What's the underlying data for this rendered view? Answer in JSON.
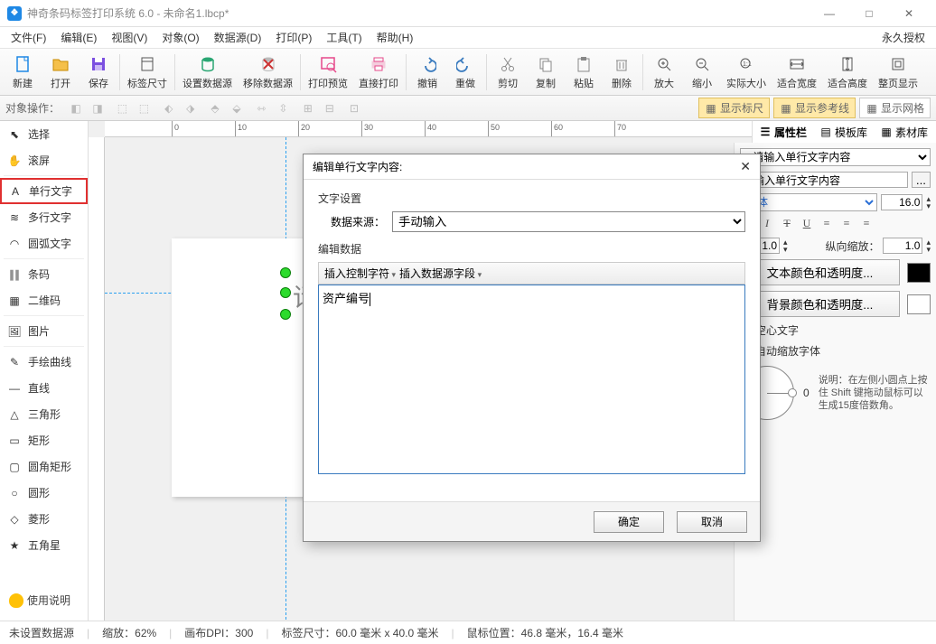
{
  "titlebar": {
    "text": "神奇条码标签打印系统 6.0 - 未命名1.lbcp*"
  },
  "menu": {
    "items": [
      "文件(F)",
      "编辑(E)",
      "视图(V)",
      "对象(O)",
      "数据源(D)",
      "打印(P)",
      "工具(T)",
      "帮助(H)"
    ],
    "rightlabel": "永久授权"
  },
  "maintb": [
    {
      "label": "新建",
      "icon": "#1e88e5",
      "shape": "doc"
    },
    {
      "label": "打开",
      "icon": "#f5a623",
      "shape": "folder"
    },
    {
      "label": "保存",
      "icon": "#7b4fe0",
      "shape": "floppy"
    },
    {
      "sep": true
    },
    {
      "label": "标签尺寸",
      "icon": "#555",
      "shape": "page"
    },
    {
      "sep": true
    },
    {
      "label": "设置数据源",
      "icon": "#2aa673",
      "shape": "db"
    },
    {
      "label": "移除数据源",
      "icon": "#c33",
      "shape": "dbx"
    },
    {
      "sep": true
    },
    {
      "label": "打印预览",
      "icon": "#e6488a",
      "shape": "preview"
    },
    {
      "label": "直接打印",
      "icon": "#e6488a",
      "shape": "printer"
    },
    {
      "sep": true
    },
    {
      "label": "撤销",
      "icon": "#3a7bbf",
      "shape": "undo"
    },
    {
      "label": "重做",
      "icon": "#3a7bbf",
      "shape": "redo"
    },
    {
      "sep": true
    },
    {
      "label": "剪切",
      "icon": "#888",
      "shape": "cut"
    },
    {
      "label": "复制",
      "icon": "#888",
      "shape": "copy"
    },
    {
      "label": "粘贴",
      "icon": "#888",
      "shape": "paste"
    },
    {
      "label": "删除",
      "icon": "#888",
      "shape": "trash"
    },
    {
      "sep": true
    },
    {
      "label": "放大",
      "icon": "#555",
      "shape": "zin"
    },
    {
      "label": "缩小",
      "icon": "#555",
      "shape": "zout"
    },
    {
      "label": "实际大小",
      "icon": "#555",
      "shape": "z100"
    },
    {
      "label": "适合宽度",
      "icon": "#555",
      "shape": "fitw"
    },
    {
      "label": "适合高度",
      "icon": "#555",
      "shape": "fith"
    },
    {
      "label": "整页显示",
      "icon": "#555",
      "shape": "fitpage"
    }
  ],
  "sectb": {
    "label": "对象操作：",
    "toggles": [
      {
        "label": "显示标尺",
        "active": true,
        "icon": "ruler"
      },
      {
        "label": "显示参考线",
        "active": true,
        "icon": "guides"
      },
      {
        "label": "显示网格",
        "active": false,
        "icon": "grid"
      }
    ]
  },
  "tools": [
    {
      "label": "选择",
      "icon": "⬉"
    },
    {
      "label": "滚屏",
      "icon": "✋"
    },
    {
      "sep": true
    },
    {
      "label": "单行文字",
      "icon": "A",
      "sel": true
    },
    {
      "label": "多行文字",
      "icon": "≋"
    },
    {
      "label": "圆弧文字",
      "icon": "◠"
    },
    {
      "sep": true
    },
    {
      "label": "条码",
      "icon": "∥∥"
    },
    {
      "label": "二维码",
      "icon": "▦"
    },
    {
      "sep": true
    },
    {
      "label": "图片",
      "icon": "🖼"
    },
    {
      "sep": true
    },
    {
      "label": "手绘曲线",
      "icon": "✎"
    },
    {
      "label": "直线",
      "icon": "―"
    },
    {
      "label": "三角形",
      "icon": "△"
    },
    {
      "label": "矩形",
      "icon": "▭"
    },
    {
      "label": "圆角矩形",
      "icon": "▢"
    },
    {
      "label": "圆形",
      "icon": "○"
    },
    {
      "label": "菱形",
      "icon": "◇"
    },
    {
      "label": "五角星",
      "icon": "★"
    }
  ],
  "helplabel": "使用说明",
  "ruler_ticks": [
    "0",
    "10",
    "20",
    "30",
    "40",
    "50",
    "60",
    "70"
  ],
  "canvas": {
    "placeholder": "请"
  },
  "rtabs": [
    {
      "label": "属性栏",
      "active": true
    },
    {
      "label": "模板库"
    },
    {
      "label": "素材库"
    }
  ],
  "props": {
    "content_placeholder": "- 请输入单行文字内容",
    "content_label_prefix": "请输入单行文字内容",
    "font": "宋体",
    "fontsize": "16.0",
    "hscale_label": "纵向缩放：",
    "hscale_left": "1.0",
    "hscale_right": "1.0",
    "btn_textcolor": "文本颜色和透明度...",
    "btn_bgcolor": "背景颜色和透明度...",
    "chk_hollow": "空心文字",
    "chk_autoscale": "自动缩放字体",
    "angle": "0",
    "angle_hint": "说明：在左侧小圆点上按住 Shift 键拖动鼠标可以生成15度倍数角。"
  },
  "dialog": {
    "title": "编辑单行文字内容:",
    "section1": "文字设置",
    "src_label": "数据来源：",
    "src_value": "手动输入",
    "section2": "编辑数据",
    "editbar": [
      "插入控制字符",
      "插入数据源字段"
    ],
    "text": "资产编号",
    "ok": "确定",
    "cancel": "取消"
  },
  "status": {
    "ds": "未设置数据源",
    "zoom": "缩放：62%",
    "dpi": "画布DPI：300",
    "size": "标签尺寸：60.0 毫米 x 40.0 毫米",
    "mouse": "鼠标位置：46.8 毫米，16.4 毫米"
  }
}
